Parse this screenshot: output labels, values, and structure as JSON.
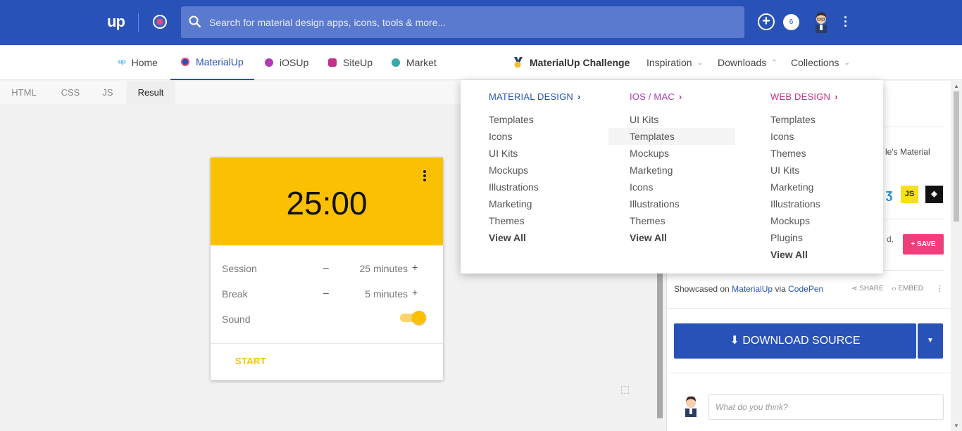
{
  "topbar": {
    "logo": "up",
    "search_placeholder": "Search for material design apps, icons, tools & more...",
    "notification_count": "6",
    "plus": "+"
  },
  "nav": {
    "items": [
      {
        "label": "Home",
        "color": "#4fb6e8"
      },
      {
        "label": "MaterialUp",
        "color": "#2952b8"
      },
      {
        "label": "iOSUp",
        "color": "#b23ab8"
      },
      {
        "label": "SiteUp",
        "color": "#c2328a"
      },
      {
        "label": "Market",
        "color": "#3aa7a7"
      }
    ],
    "challenge": "MaterialUp Challenge",
    "inspiration": "Inspiration",
    "downloads": "Downloads",
    "collections": "Collections"
  },
  "code_tabs": [
    "HTML",
    "CSS",
    "JS",
    "Result"
  ],
  "pomodoro": {
    "time": "25:00",
    "rows": [
      {
        "label": "Session",
        "minus": "–",
        "value": "25 minutes",
        "plus": "+"
      },
      {
        "label": "Break",
        "minus": "–",
        "value": "5 minutes",
        "plus": "+"
      },
      {
        "label": "Sound"
      }
    ],
    "sound_on": true,
    "start": "START"
  },
  "dropdown": {
    "columns": [
      {
        "title": "MATERIAL DESIGN",
        "color": "#2952b8",
        "items": [
          "Templates",
          "Icons",
          "UI Kits",
          "Mockups",
          "Illustrations",
          "Marketing",
          "Themes"
        ],
        "view_all": "View All"
      },
      {
        "title": "IOS / MAC",
        "color": "#b23ab8",
        "items": [
          "UI Kits",
          "Templates",
          "Mockups",
          "Marketing",
          "Icons",
          "Illustrations",
          "Themes"
        ],
        "view_all": "View All",
        "highlighted": "Templates"
      },
      {
        "title": "WEB DESIGN",
        "color": "#c2328a",
        "items": [
          "Templates",
          "Icons",
          "Themes",
          "UI Kits",
          "Marketing",
          "Illustrations",
          "Mockups",
          "Plugins"
        ],
        "view_all": "View All"
      }
    ]
  },
  "side": {
    "material_fragment": "le's Material",
    "tech": [
      "JS"
    ],
    "text_fragment": "d,",
    "save": "+ SAVE",
    "showcased_prefix": "Showcased on",
    "showcased_site": "MaterialUp",
    "via": "via",
    "codepen": "CodePen",
    "share": "SHARE",
    "embed": "EMBED",
    "download": "DOWNLOAD SOURCE",
    "comment_placeholder": "What do you think?"
  }
}
